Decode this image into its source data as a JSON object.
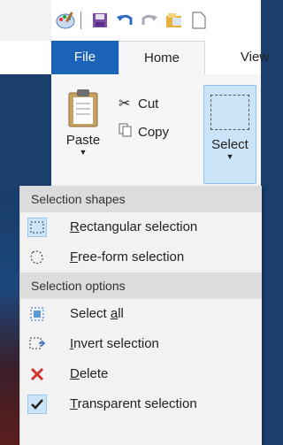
{
  "tabs": {
    "file": "File",
    "home": "Home",
    "view": "View"
  },
  "clipboard": {
    "paste": "Paste",
    "cut": "Cut",
    "copy": "Copy"
  },
  "image_group": {
    "select": "Select"
  },
  "menu": {
    "shapes_header": "Selection shapes",
    "shapes": [
      {
        "label": "Rectangular selection",
        "accel_index": 0,
        "checked": true,
        "icon": "rectangle-select-icon"
      },
      {
        "label": "Free-form selection",
        "accel_index": 0,
        "checked": false,
        "icon": "freeform-select-icon"
      }
    ],
    "options_header": "Selection options",
    "options": [
      {
        "label": "Select all",
        "accel": "a",
        "icon": "select-all-icon"
      },
      {
        "label": "Invert selection",
        "accel": "I",
        "icon": "invert-selection-icon"
      },
      {
        "label": "Delete",
        "accel": "D",
        "icon": "delete-x-icon"
      },
      {
        "label": "Transparent selection",
        "accel": "T",
        "checked": true,
        "icon": "checkmark-icon"
      }
    ]
  },
  "colors": {
    "file_tab": "#1a63b7",
    "select_active": "#cce4f7",
    "delete_x": "#d0312d"
  }
}
